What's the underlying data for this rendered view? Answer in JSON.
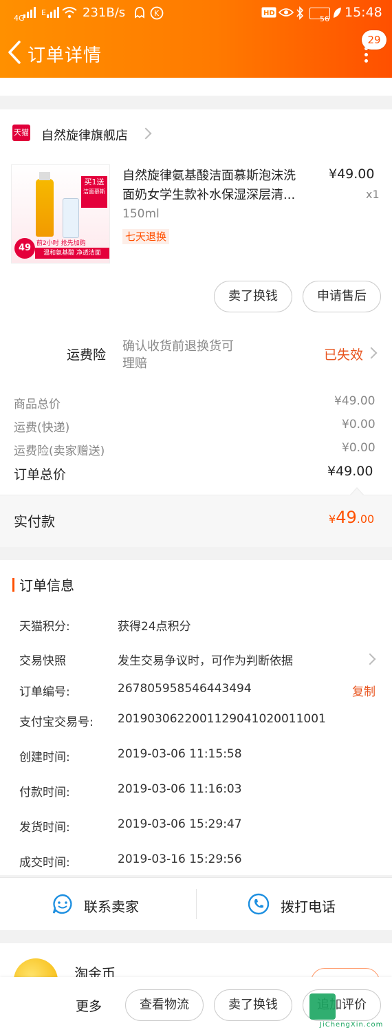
{
  "status_bar": {
    "signal_left": "4G",
    "signal_right": "E",
    "speed": "231B/s",
    "battery": "56",
    "time": "15:48"
  },
  "header": {
    "title": "订单详情",
    "message_count": "29"
  },
  "store": {
    "badge": "天猫",
    "name": "自然旋律旗舰店"
  },
  "product": {
    "name_line1": "自然旋律氨基酸洁面慕斯泡沫洗",
    "name_line2": "面奶女学生款补水保湿深层清...",
    "price": "¥49.00",
    "quantity": "x1",
    "spec": "150ml",
    "tag": "七天退换",
    "image_texts": {
      "top": "买1送",
      "top_sub": "洁面慕斯",
      "bottom_badge": "49",
      "bottom_banner1": "前2小时 抢先加购",
      "bottom_banner2": "温和氨基酸 净透洁面"
    }
  },
  "product_actions": {
    "sell_label": "卖了换钱",
    "aftersale_label": "申请售后"
  },
  "insurance": {
    "label": "运费险",
    "desc_line1": "确认收货前退换货可",
    "desc_line2": "理赔",
    "status": "已失效"
  },
  "costs": {
    "goods_label": "商品总价",
    "goods_value": "¥49.00",
    "shipping_label": "运费(快递)",
    "shipping_value": "¥0.00",
    "insurance_label": "运费险(卖家赠送)",
    "insurance_value": "¥0.00",
    "total_label": "订单总价",
    "total_value": "¥49.00",
    "paid_label": "实付款",
    "paid_currency": "¥",
    "paid_integer": "49",
    "paid_decimal": ".00"
  },
  "order_info": {
    "section_title": "订单信息",
    "rows": [
      {
        "label": "天猫积分:",
        "value": "获得24点积分"
      },
      {
        "label": "交易快照",
        "value": "发生交易争议时，可作为判断依据"
      },
      {
        "label": "订单编号:",
        "value": "267805958546443494"
      },
      {
        "label": "支付宝交易号:",
        "value": "2019030622001129041020011001"
      },
      {
        "label": "创建时间:",
        "value": "2019-03-06 11:15:58"
      },
      {
        "label": "付款时间:",
        "value": "2019-03-06 11:16:03"
      },
      {
        "label": "发货时间:",
        "value": "2019-03-06 15:29:47"
      },
      {
        "label": "成交时间:",
        "value": "2019-03-16 15:29:56"
      }
    ],
    "copy_label": "复制"
  },
  "contact": {
    "seller_label": "联系卖家",
    "phone_label": "拨打电话"
  },
  "coin": {
    "label": "淘金币"
  },
  "bottom_bar": {
    "more_label": "更多",
    "logistics_label": "查看物流",
    "sell_label": "卖了换钱",
    "review_label": "追加评价"
  },
  "watermark": {
    "text": "JiChengXin.com"
  },
  "colors": {
    "accent": "#ff5000",
    "orange_text": "#e8541e",
    "header_start": "#ff9000",
    "header_end": "#ff5000",
    "contact_blue": "#1d8fe0"
  }
}
